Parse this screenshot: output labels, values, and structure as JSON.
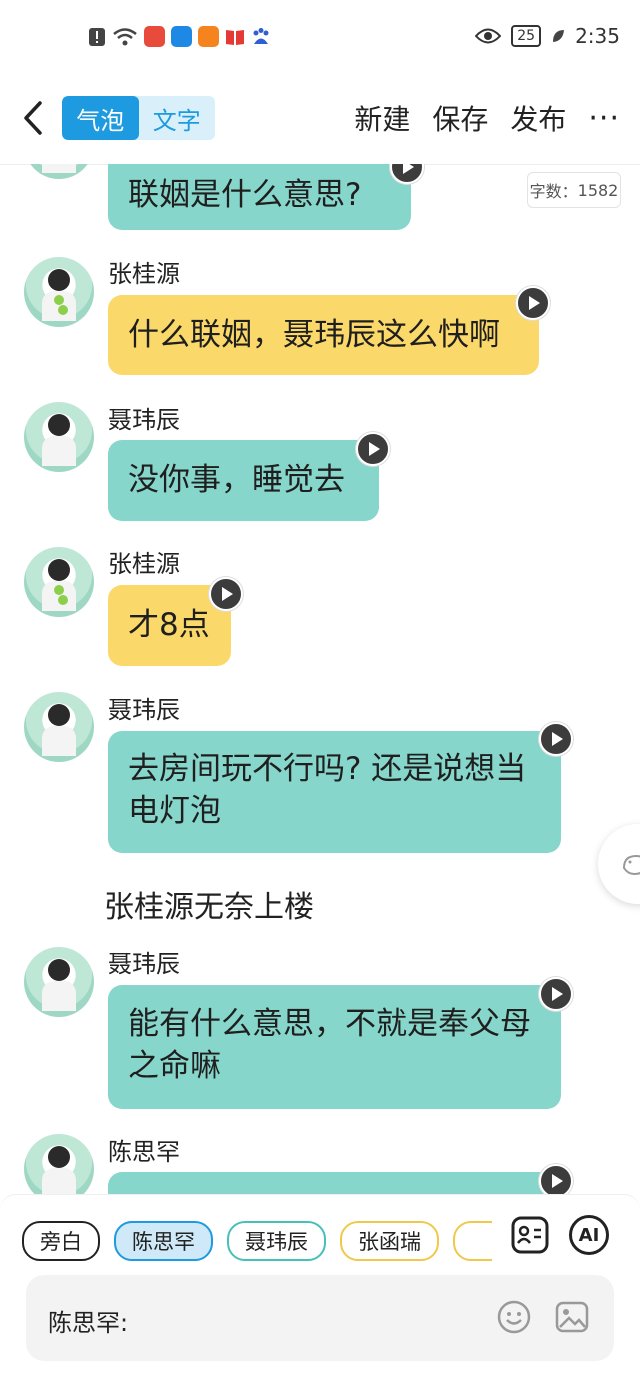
{
  "status_bar": {
    "time": "2:35",
    "battery": "25",
    "icons": [
      "alert-icon",
      "wifi-icon",
      "app-red-icon",
      "app-blue-icon",
      "app-orange-icon",
      "book-icon",
      "baidu-icon",
      "eye-icon",
      "leaf-icon"
    ]
  },
  "header": {
    "mode_tabs": [
      {
        "label": "气泡",
        "active": true
      },
      {
        "label": "文字",
        "active": false
      }
    ],
    "actions": {
      "new": "新建",
      "save": "保存",
      "publish": "发布",
      "more": "···"
    }
  },
  "word_count": {
    "label": "字数：",
    "value": "1582"
  },
  "messages": [
    {
      "speaker": "",
      "text": "联姻是什么意思?",
      "color": "teal"
    },
    {
      "speaker": "张桂源",
      "text": "什么联姻，聂玮辰这么快啊",
      "color": "yellow"
    },
    {
      "speaker": "聂玮辰",
      "text": "没你事，睡觉去",
      "color": "teal"
    },
    {
      "speaker": "张桂源",
      "text": "才8点",
      "color": "yellow"
    },
    {
      "speaker": "聂玮辰",
      "text_line1": "去房间玩不行吗? 还是说想当",
      "text_line2": "电灯泡",
      "color": "teal"
    },
    {
      "speaker": "聂玮辰",
      "text_line1": "能有什么意思，不就是奉父母",
      "text_line2": "之命嘛",
      "color": "teal"
    },
    {
      "speaker": "陈思罕",
      "text": "",
      "color": "teal"
    }
  ],
  "narration": "张桂源无奈上楼",
  "bottom": {
    "chips": [
      {
        "label": "旁白",
        "style": "plain"
      },
      {
        "label": "陈思罕",
        "style": "sel"
      },
      {
        "label": "聂玮辰",
        "style": "teal"
      },
      {
        "label": "张函瑞",
        "style": "yellow"
      }
    ],
    "ai_label": "AI",
    "input_speaker": "陈思罕:",
    "input_value": ""
  },
  "colors": {
    "accent": "#1e9be0",
    "teal_bubble": "#87d6cb",
    "yellow_bubble": "#fbd86a"
  }
}
